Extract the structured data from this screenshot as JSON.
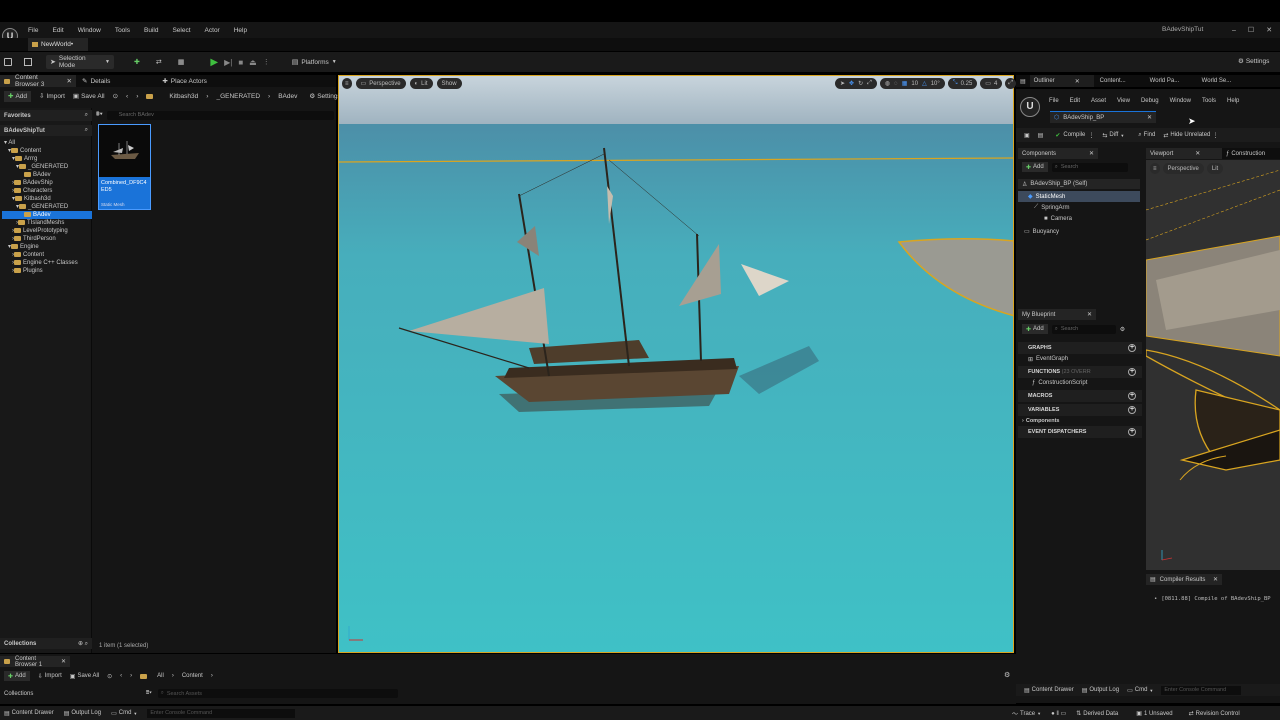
{
  "menu": {
    "items": [
      "File",
      "Edit",
      "Window",
      "Tools",
      "Build",
      "Select",
      "Actor",
      "Help"
    ],
    "project": "BAdevShipTut"
  },
  "level_tab": "NewWorld•",
  "toolbar": {
    "mode": "Selection Mode",
    "platforms": "Platforms",
    "settings": "Settings"
  },
  "left_tabs": {
    "content_browser": "Content Browser 3",
    "details": "Details",
    "place_actors": "Place Actors"
  },
  "cb_toolbar": {
    "add": "Add",
    "import": "Import",
    "save_all": "Save All",
    "settings": "Settings",
    "crumbs": [
      "Kitbash3d",
      "_GENERATED",
      "BAdev"
    ]
  },
  "favorites": "Favorites",
  "project_root": "BAdevShipTut",
  "search_placeholder": "Search BAdev",
  "tree": [
    "All",
    "Content",
    "Arrrg",
    "_GENERATED",
    "BAdev",
    "BAdevShip",
    "Characters",
    "Kitbash3d",
    "_GENERATED",
    "BAdev",
    "TIslandMeshs",
    "LevelPrototyping",
    "ThirdPerson",
    "Engine",
    "Content",
    "Engine C++ Classes",
    "Plugins"
  ],
  "asset": {
    "name": "Combined_DF9C4ED5",
    "type": "Static Mesh"
  },
  "collections": "Collections",
  "items_status": "1 item (1 selected)",
  "viewport": {
    "perspective": "Perspective",
    "lit": "Lit",
    "show": "Show",
    "grid_value": "10",
    "rot_value": "10°",
    "scale_value": "0.25",
    "cam_speed": "4"
  },
  "right_tabs": [
    "Outliner",
    "Content...",
    "World Pa...",
    "World Se..."
  ],
  "bp": {
    "menu": [
      "File",
      "Edit",
      "Asset",
      "View",
      "Debug",
      "Window",
      "Tools",
      "Help"
    ],
    "tab": "BAdevShip_BP",
    "compile": "Compile",
    "diff": "Diff",
    "find": "Find",
    "hide": "Hide Unrelated",
    "components_tab": "Components",
    "add": "Add",
    "search": "Search",
    "components": [
      "BAdevShip_BP (Self)",
      "StaticMesh",
      "SpringArm",
      "Camera",
      "Buoyancy"
    ],
    "viewport_tab": "Viewport",
    "construction_tab": "Construction",
    "vp_perspective": "Perspective",
    "vp_lit": "Lit",
    "my_blueprint": "My Blueprint",
    "sections": {
      "graphs": "GRAPHS",
      "event_graph": "EventGraph",
      "functions": "FUNCTIONS",
      "overridable": "(23 OVERR",
      "construction_script": "ConstructionScript",
      "macros": "MACROS",
      "variables": "VARIABLES",
      "components": "Components",
      "dispatchers": "EVENT DISPATCHERS"
    },
    "compiler_results": "Compiler Results",
    "compile_log": "[0811.88] Compile of BAdevShip_BP",
    "drawer": "Content Drawer",
    "output_log": "Output Log",
    "cmd": "Cmd",
    "console": "Enter Console Command"
  },
  "cb2": {
    "tab": "Content Browser 1",
    "add": "Add",
    "import": "Import",
    "save_all": "Save All",
    "crumbs": [
      "All",
      "Content"
    ],
    "collections": "Collections",
    "search": "Search Assets"
  },
  "status": {
    "drawer": "Content Drawer",
    "output_log": "Output Log",
    "cmd": "Cmd",
    "console": "Enter Console Command",
    "trace": "Trace",
    "derived": "Derived Data",
    "unsaved": "1 Unsaved",
    "revision": "Revision Control"
  },
  "colors": {
    "accent_blue": "#1a73d9",
    "play_green": "#3fbf3f",
    "gold_outline": "#d9a520",
    "water": "#3fbcc0"
  }
}
